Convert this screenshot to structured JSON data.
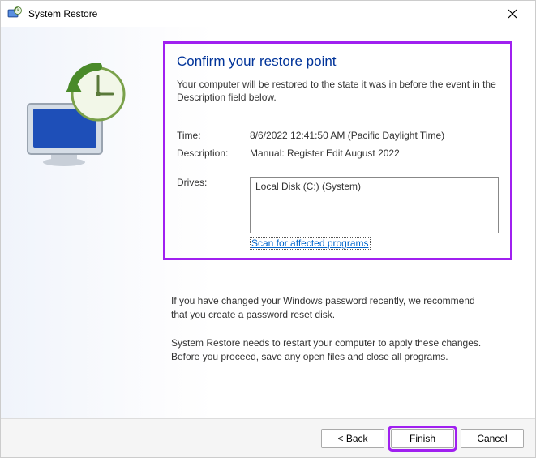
{
  "window": {
    "title": "System Restore"
  },
  "content": {
    "heading": "Confirm your restore point",
    "intro": "Your computer will be restored to the state it was in before the event in the Description field below.",
    "time_label": "Time:",
    "time_value": "8/6/2022 12:41:50 AM (Pacific Daylight Time)",
    "description_label": "Description:",
    "description_value": "Manual: Register Edit August 2022",
    "drives_label": "Drives:",
    "drives_value": "Local Disk (C:) (System)",
    "scan_link": "Scan for affected programs",
    "note1": "If you have changed your Windows password recently, we recommend that you create a password reset disk.",
    "note2": "System Restore needs to restart your computer to apply these changes. Before you proceed, save any open files and close all programs."
  },
  "buttons": {
    "back": "< Back",
    "finish": "Finish",
    "cancel": "Cancel"
  }
}
